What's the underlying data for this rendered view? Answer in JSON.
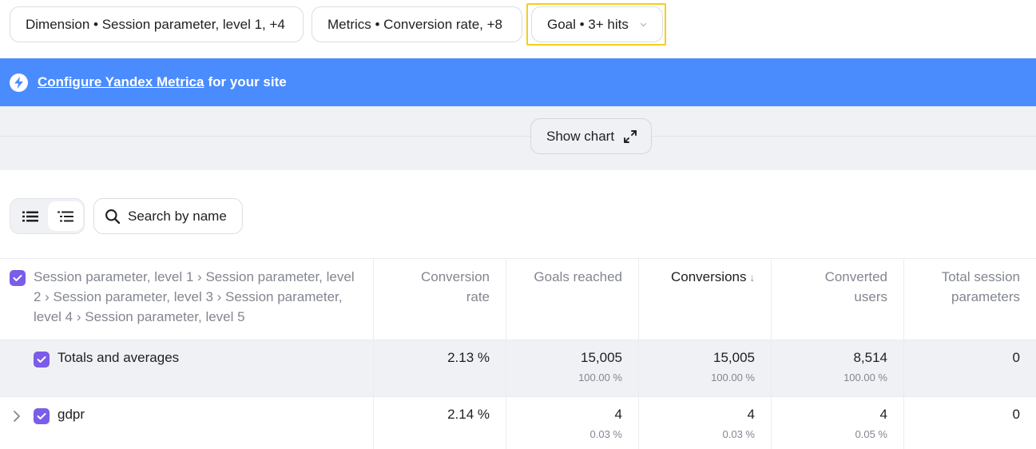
{
  "filters": {
    "dimension_label": "Dimension • Session parameter, level 1, +4",
    "metrics_label": "Metrics • Conversion rate, +8",
    "goal_label": "Goal • 3+ hits"
  },
  "banner": {
    "link_text": "Configure Yandex Metrica",
    "suffix_text": "for your site"
  },
  "chart_toggle": {
    "label": "Show chart"
  },
  "search": {
    "placeholder": "Search by name"
  },
  "table": {
    "dimension_header": "Session parameter, level 1 › Session parameter, level 2 › Session parameter, level 3 › Session parameter, level 4 › Session parameter, level 5",
    "columns": [
      {
        "line1": "Conversion",
        "line2": "rate"
      },
      {
        "line1": "Goals reached",
        "line2": ""
      },
      {
        "line1": "Conversions",
        "line2": "",
        "sort": "↓"
      },
      {
        "line1": "Converted",
        "line2": "users"
      },
      {
        "line1": "Total session",
        "line2": "parameters"
      }
    ],
    "totals": {
      "label": "Totals and averages",
      "conversion_rate": "2.13 %",
      "goals_reached": "15,005",
      "goals_reached_pct": "100.00 %",
      "conversions": "15,005",
      "conversions_pct": "100.00 %",
      "converted_users": "8,514",
      "converted_users_pct": "100.00 %",
      "total_session_parameters": "0"
    },
    "rows": [
      {
        "label": "gdpr",
        "conversion_rate": "2.14 %",
        "goals_reached": "4",
        "goals_reached_pct": "0.03 %",
        "conversions": "4",
        "conversions_pct": "0.03 %",
        "converted_users": "4",
        "converted_users_pct": "0.05 %",
        "total_session_parameters": "0"
      }
    ]
  },
  "colors": {
    "banner": "#4a8cfe",
    "checkbox": "#7b5de8",
    "highlight": "#f4cf1c"
  }
}
